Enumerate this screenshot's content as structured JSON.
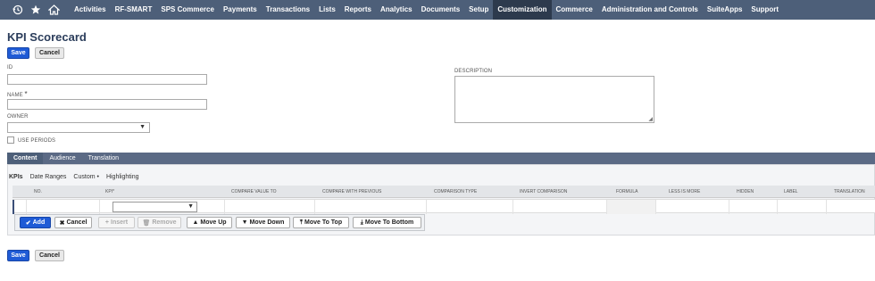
{
  "nav": {
    "icons": [
      "history-icon",
      "star-icon",
      "home-icon"
    ],
    "items": [
      {
        "label": "Activities"
      },
      {
        "label": "RF-SMART"
      },
      {
        "label": "SPS Commerce"
      },
      {
        "label": "Payments"
      },
      {
        "label": "Transactions"
      },
      {
        "label": "Lists"
      },
      {
        "label": "Reports"
      },
      {
        "label": "Analytics"
      },
      {
        "label": "Documents"
      },
      {
        "label": "Setup"
      },
      {
        "label": "Customization"
      },
      {
        "label": "Commerce"
      },
      {
        "label": "Administration and Controls"
      },
      {
        "label": "SuiteApps"
      },
      {
        "label": "Support"
      }
    ],
    "active": "Customization",
    "bg_color": "#4d5f79",
    "active_color": "#2d3a4d"
  },
  "page": {
    "title": "KPI Scorecard",
    "save_label": "Save",
    "cancel_label": "Cancel"
  },
  "form": {
    "id_label": "ID",
    "id_value": "",
    "name_label": "NAME",
    "name_required": "*",
    "name_value": "",
    "owner_label": "OWNER",
    "owner_value": "",
    "use_periods_label": "USE PERIODS",
    "use_periods_checked": false,
    "description_label": "DESCRIPTION",
    "description_value": ""
  },
  "tabs": [
    {
      "label": "Content",
      "active": true
    },
    {
      "label": "Audience",
      "active": false
    },
    {
      "label": "Translation",
      "active": false
    }
  ],
  "subtabs": [
    {
      "label": "KPIs",
      "active": true
    },
    {
      "label": "Date Ranges",
      "active": false
    },
    {
      "label": "Custom •",
      "active": false
    },
    {
      "label": "Highlighting",
      "active": false
    }
  ],
  "grid": {
    "columns": [
      "NO.",
      "KPI",
      "COMPARE VALUE TO",
      "COMPARE WITH PREVIOUS",
      "COMPARISON TYPE",
      "INVERT COMPARISON",
      "FORMULA",
      "LESS IS MORE",
      "HIDDEN",
      "LABEL",
      "TRANSLATION"
    ],
    "kpi_required": "*"
  },
  "actions": {
    "add": "Add",
    "cancel": "Cancel",
    "insert": "Insert",
    "remove": "Remove",
    "move_up": "Move Up",
    "move_down": "Move Down",
    "move_to_top": "Move To Top",
    "move_to_bottom": "Move To Bottom"
  },
  "colors": {
    "primary_button": "#1f5bd6",
    "title": "#2b3d5b",
    "tab_bar": "#5b6a85"
  }
}
